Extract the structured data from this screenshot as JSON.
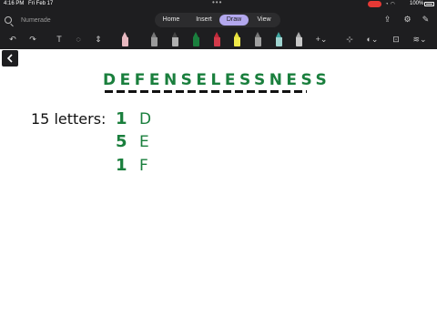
{
  "status_bar": {
    "time": "4:16 PM",
    "date": "Fri Feb 17",
    "battery": "100%"
  },
  "search": {
    "placeholder": "Numerade"
  },
  "tabs": [
    {
      "label": "Home"
    },
    {
      "label": "Insert"
    },
    {
      "label": "Draw",
      "selected": true
    },
    {
      "label": "View"
    }
  ],
  "colors": {
    "accent": "#b3a8ee",
    "ink_green": "#1a7f3d",
    "ink_black": "#111111"
  },
  "canvas": {
    "word": "DEFENSELESSNESS",
    "label": "15 letters:",
    "counts": [
      {
        "count": "1",
        "letter": "D"
      },
      {
        "count": "5",
        "letter": "E"
      },
      {
        "count": "1",
        "letter": "F"
      }
    ]
  }
}
